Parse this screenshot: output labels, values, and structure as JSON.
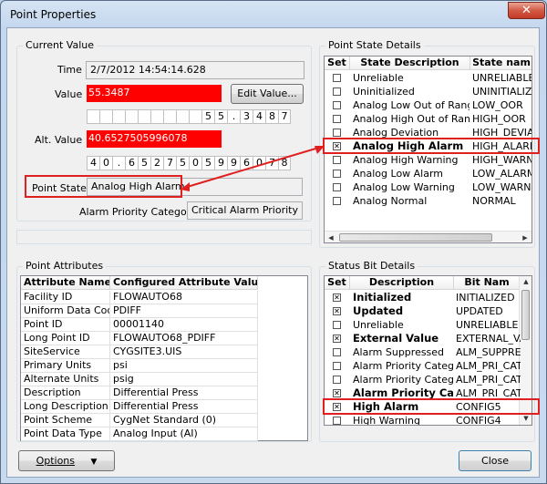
{
  "window": {
    "title": "Point Properties",
    "close_glyph": "✕"
  },
  "current_value": {
    "group_label": "Current Value",
    "time_label": "Time",
    "time_value": "2/7/2012 14:54:14.628",
    "value_label": "Value",
    "value": "55.3487",
    "edit_button": "Edit Value...",
    "value_digits": [
      "",
      "",
      "",
      "",
      "",
      "",
      "",
      "",
      "",
      "5",
      "5",
      ".",
      "3",
      "4",
      "8",
      "7"
    ],
    "alt_label": "Alt. Value",
    "alt_value": "40.6527505996078",
    "alt_digits": [
      "4",
      "0",
      ".",
      "6",
      "5",
      "2",
      "7",
      "5",
      "0",
      "5",
      "9",
      "9",
      "6",
      "0",
      "7",
      "8"
    ],
    "point_state_label": "Point State",
    "point_state_value": "Analog High Alarm",
    "alarm_priority_label": "Alarm Priority Category",
    "alarm_priority_value": "Critical Alarm Priority"
  },
  "point_state_details": {
    "group_label": "Point State Details",
    "headers": [
      "Set",
      "State Description",
      "State nam"
    ],
    "rows": [
      {
        "set": "",
        "desc": "Unreliable",
        "name": "UNRELIABLE",
        "bold": false
      },
      {
        "set": "",
        "desc": "Uninitialized",
        "name": "UNINITIALIZE",
        "bold": false
      },
      {
        "set": "",
        "desc": "Analog Low Out of Range",
        "name": "LOW_OOR",
        "bold": false
      },
      {
        "set": "",
        "desc": "Analog High Out of Range",
        "name": "HIGH_OOR",
        "bold": false
      },
      {
        "set": "",
        "desc": "Analog Deviation",
        "name": "HIGH_DEVIAT",
        "bold": false
      },
      {
        "set": "☒",
        "desc": "Analog High Alarm",
        "name": "HIGH_ALARM",
        "bold": true
      },
      {
        "set": "",
        "desc": "Analog High Warning",
        "name": "HIGH_WARNI",
        "bold": false
      },
      {
        "set": "",
        "desc": "Analog Low Alarm",
        "name": "LOW_ALARM",
        "bold": false
      },
      {
        "set": "",
        "desc": "Analog Low Warning",
        "name": "LOW_WARNI",
        "bold": false
      },
      {
        "set": "",
        "desc": "Analog Normal",
        "name": "NORMAL",
        "bold": false
      }
    ]
  },
  "point_attributes": {
    "group_label": "Point Attributes",
    "headers": [
      "Attribute Name",
      "Configured Attribute Value"
    ],
    "rows": [
      [
        "Facility ID",
        "FLOWAUTO68"
      ],
      [
        "Uniform Data Code",
        "PDIFF"
      ],
      [
        "Point ID",
        "00001140"
      ],
      [
        "Long Point ID",
        "FLOWAUTO68_PDIFF"
      ],
      [
        "SiteService",
        "CYGSITE3.UIS"
      ],
      [
        "Primary Units",
        "psi"
      ],
      [
        "Alternate Units",
        "psig"
      ],
      [
        "Description",
        "Differential Press"
      ],
      [
        "Long Description",
        "Differential Press"
      ],
      [
        "Point Scheme",
        "CygNet Standard (0)"
      ],
      [
        "Point Data Type",
        "Analog Input (AI)"
      ]
    ]
  },
  "status_bit_details": {
    "group_label": "Status Bit Details",
    "headers": [
      "Set",
      "Description",
      "Bit Nam"
    ],
    "rows": [
      {
        "set": "☒",
        "desc": "Initialized",
        "name": "INITIALIZED",
        "bold": true
      },
      {
        "set": "☒",
        "desc": "Updated",
        "name": "UPDATED",
        "bold": true
      },
      {
        "set": "",
        "desc": "Unreliable",
        "name": "UNRELIABLE",
        "bold": false
      },
      {
        "set": "☒",
        "desc": "External Value",
        "name": "EXTERNAL_VA",
        "bold": true
      },
      {
        "set": "",
        "desc": "Alarm Suppressed",
        "name": "ALM_SUPPRES",
        "bold": false
      },
      {
        "set": "",
        "desc": "Alarm Priority Categor",
        "name": "ALM_PRI_CAT",
        "bold": false
      },
      {
        "set": "",
        "desc": "Alarm Priority Categor",
        "name": "ALM_PRI_CAT",
        "bold": false
      },
      {
        "set": "☒",
        "desc": "Alarm Priority Categ",
        "name": "ALM_PRI_CAT",
        "bold": true
      },
      {
        "set": "☒",
        "desc": "High Alarm",
        "name": "CONFIG5",
        "bold": true
      },
      {
        "set": "",
        "desc": "High Warning",
        "name": "CONFIG4",
        "bold": false
      }
    ]
  },
  "footer": {
    "options_button": "Options",
    "options_arrow": "▼",
    "close_button": "Close"
  },
  "colors": {
    "highlight_red": "#ff0000",
    "annotation_red": "#e02020"
  }
}
